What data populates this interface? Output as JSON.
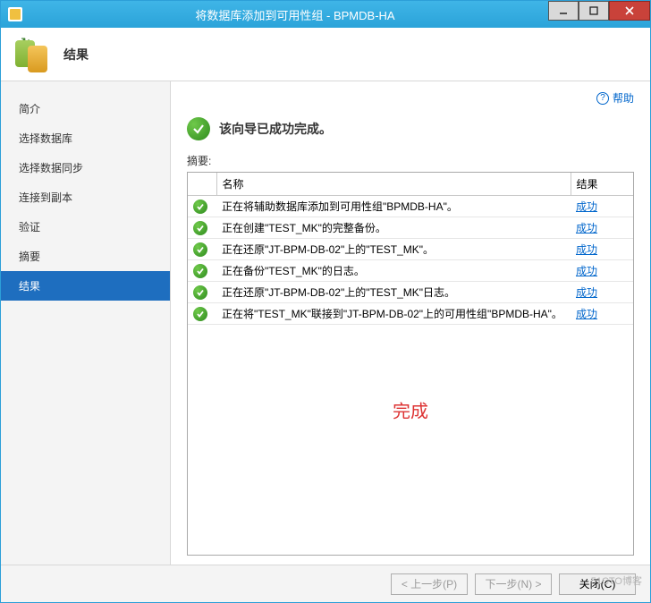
{
  "window": {
    "title": "将数据库添加到可用性组 - BPMDB-HA"
  },
  "header": {
    "title": "结果"
  },
  "sidebar": {
    "items": [
      {
        "label": "简介"
      },
      {
        "label": "选择数据库"
      },
      {
        "label": "选择数据同步"
      },
      {
        "label": "连接到副本"
      },
      {
        "label": "验证"
      },
      {
        "label": "摘要"
      },
      {
        "label": "结果"
      }
    ],
    "active_index": 6
  },
  "content": {
    "help_label": "帮助",
    "success_message": "该向导已成功完成。",
    "summary_label": "摘要:",
    "table": {
      "col_name": "名称",
      "col_result": "结果",
      "rows": [
        {
          "name": "正在将辅助数据库添加到可用性组\"BPMDB-HA\"。",
          "result": "成功"
        },
        {
          "name": "正在创建\"TEST_MK\"的完整备份。",
          "result": "成功"
        },
        {
          "name": "正在还原\"JT-BPM-DB-02\"上的\"TEST_MK\"。",
          "result": "成功"
        },
        {
          "name": "正在备份\"TEST_MK\"的日志。",
          "result": "成功"
        },
        {
          "name": "正在还原\"JT-BPM-DB-02\"上的\"TEST_MK\"日志。",
          "result": "成功"
        },
        {
          "name": "正在将\"TEST_MK\"联接到\"JT-BPM-DB-02\"上的可用性组\"BPMDB-HA\"。",
          "result": "成功"
        }
      ]
    },
    "done_overlay": "完成"
  },
  "footer": {
    "prev": "< 上一步(P)",
    "next": "下一步(N) >",
    "close": "关闭(C)"
  },
  "watermark": "51CTO博客"
}
